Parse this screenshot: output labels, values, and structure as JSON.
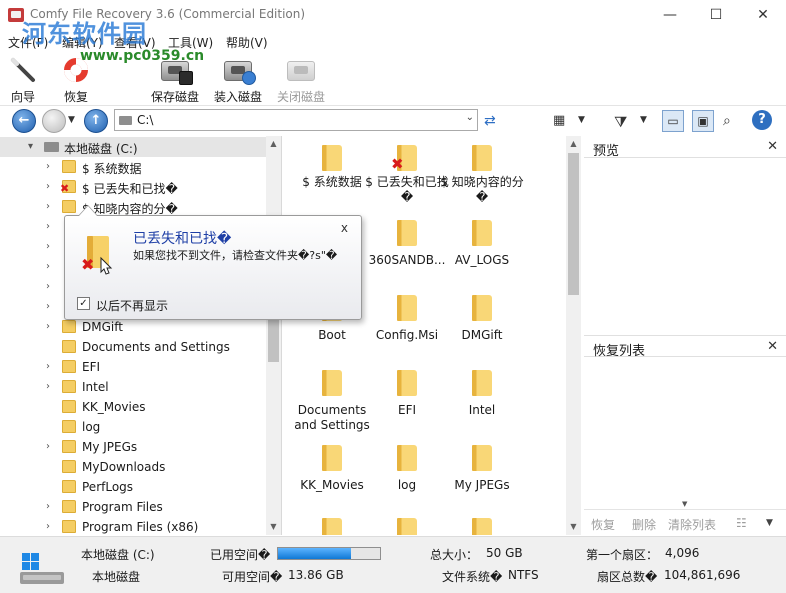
{
  "window": {
    "title": "Comfy File Recovery 3.6 (Commercial Edition)",
    "watermark": "河东软件园",
    "watermark_url": "www.pc0359.cn",
    "minimize": "—",
    "maximize": "☐",
    "close": "✕"
  },
  "menu": [
    {
      "label": "文件(F)"
    },
    {
      "label": "编辑(Y)"
    },
    {
      "label": "查看(V)"
    },
    {
      "label": "工具(W)"
    },
    {
      "label": "帮助(V)"
    }
  ],
  "toolbar": {
    "wizard": "向导",
    "recover": "恢复",
    "save_disk": "保存磁盘",
    "load_disk": "装入磁盘",
    "close_disk": "关闭磁盘"
  },
  "address": {
    "path": "C:\\"
  },
  "tree": {
    "root": "本地磁盘 (C:)",
    "items": [
      {
        "label": "$ 系统数据"
      },
      {
        "label": "$ 已丢失和已找�"
      },
      {
        "label": "$ 知晓内容的分�"
      },
      {
        "label": "DMGift"
      },
      {
        "label": "Documents and Settings"
      },
      {
        "label": "EFI"
      },
      {
        "label": "Intel"
      },
      {
        "label": "KK_Movies"
      },
      {
        "label": "log"
      },
      {
        "label": "My JPEGs"
      },
      {
        "label": "MyDownloads"
      },
      {
        "label": "PerfLogs"
      },
      {
        "label": "Program Files"
      },
      {
        "label": "Program Files (x86)"
      }
    ]
  },
  "files": [
    {
      "label": "$ 系统数据"
    },
    {
      "label": "$ 已丢失和已找�"
    },
    {
      "label": "$ 知晓内容的分�"
    },
    {
      "label": "360SANDB..."
    },
    {
      "label": "AV_LOGS"
    },
    {
      "label": "Boot"
    },
    {
      "label": "Config.Msi"
    },
    {
      "label": "DMGift"
    },
    {
      "label": "Documents and Settings"
    },
    {
      "label": "EFI"
    },
    {
      "label": "Intel"
    },
    {
      "label": "KK_Movies"
    },
    {
      "label": "log"
    },
    {
      "label": "My JPEGs"
    }
  ],
  "preview": {
    "title": "预览",
    "close": "✕"
  },
  "recovery_list": {
    "title": "恢复列表",
    "close": "✕",
    "recover": "恢复",
    "delete": "删除",
    "clear": "清除列表"
  },
  "tooltip": {
    "title": "已丢失和已找�",
    "body": "如果您找不到文件，请检查文件夹�?s\"�",
    "close": "x",
    "checkbox_label": "以后不再显示",
    "checked": true
  },
  "status": {
    "drive_name": "本地磁盘 (C:)",
    "drive_type": "本地磁盘",
    "used_label": "已用空间�",
    "used_fraction": 0.72,
    "free_label": "可用空间�",
    "free_value": "13.86 GB",
    "total_label": "总大小：",
    "total_value": "50 GB",
    "fs_label": "文件系统�",
    "fs_value": "NTFS",
    "first_sector_label": "第一个扇区：",
    "first_sector_value": "4,096",
    "total_sectors_label": "扇区总数�",
    "total_sectors_value": "104,861,696"
  }
}
